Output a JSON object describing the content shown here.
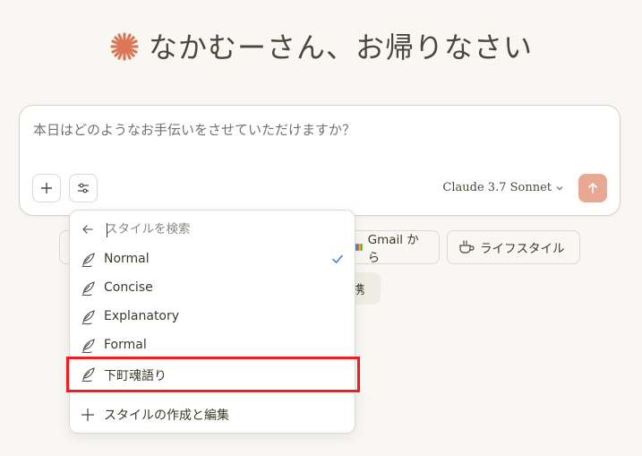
{
  "greeting": {
    "text": "なかむーさん、お帰りなさい"
  },
  "composer": {
    "placeholder": "本日はどのようなお手伝いをさせていただけますか？",
    "model_label": "Claude 3.7 Sonnet"
  },
  "chips": {
    "gmail_label": "Gmail から",
    "life_label": "ライフスタイル",
    "connect_label": "携"
  },
  "style_menu": {
    "search_placeholder": "スタイルを検索",
    "items": [
      {
        "label": "Normal",
        "selected": true
      },
      {
        "label": "Concise",
        "selected": false
      },
      {
        "label": "Explanatory",
        "selected": false
      },
      {
        "label": "Formal",
        "selected": false
      },
      {
        "label": "下町魂語り",
        "selected": false
      }
    ],
    "create_label": "スタイルの作成と編集"
  },
  "colors": {
    "accent": "#d97757",
    "send_button": "#e8a893",
    "check": "#2f7ddc",
    "highlight_box": "#f01f1f",
    "background": "#f9f7f3"
  }
}
